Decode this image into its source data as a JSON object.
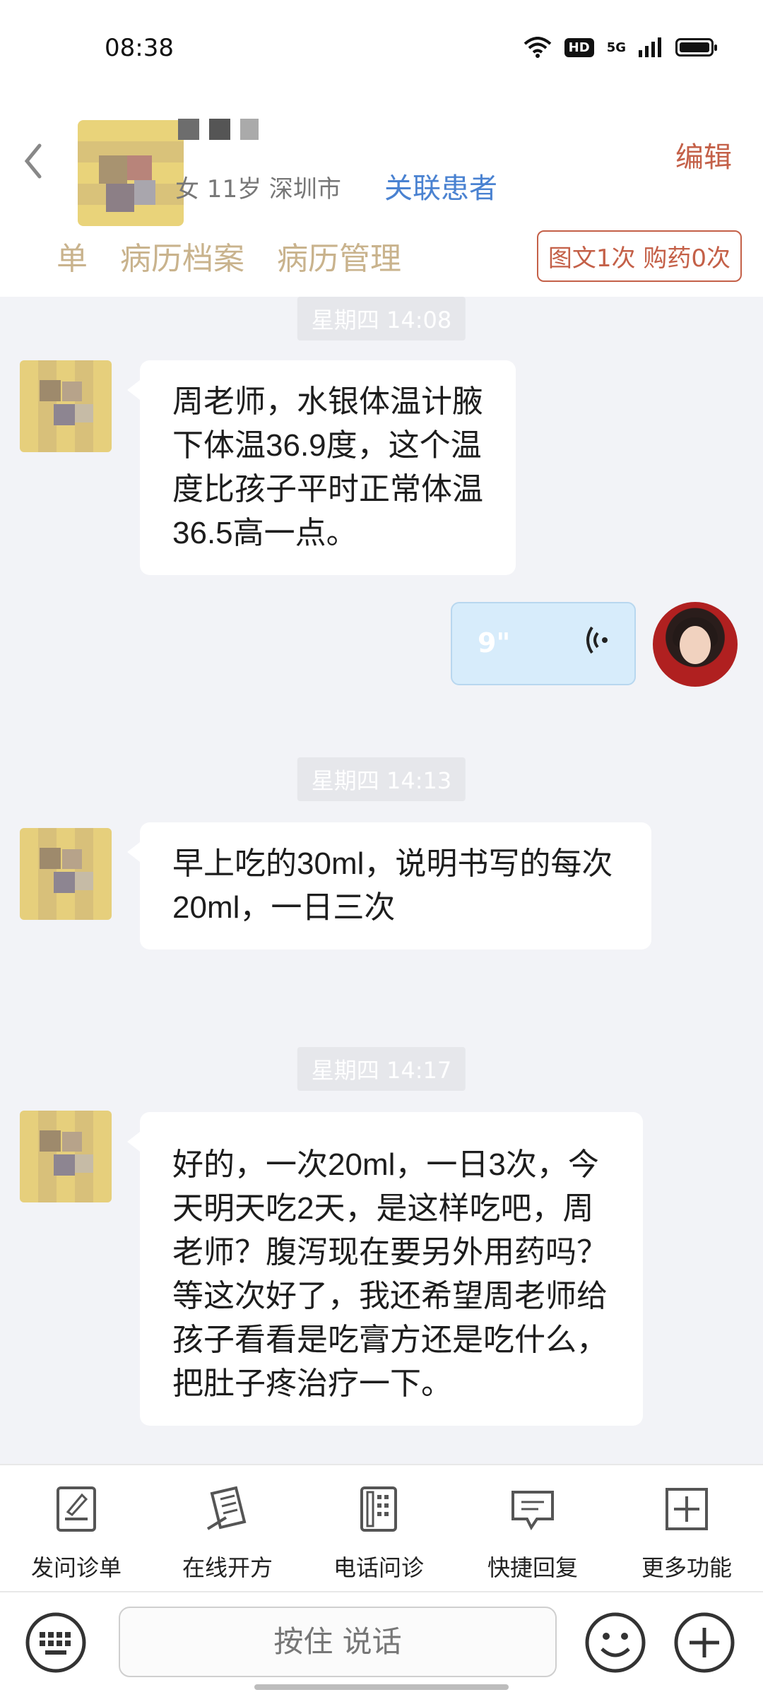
{
  "status_bar": {
    "time": "08:38",
    "hd": "HD",
    "network": "5G"
  },
  "header": {
    "patient_meta": "女 11岁  深圳市",
    "link_patient": "关联患者",
    "edit": "编辑",
    "tabs": [
      "单",
      "病历档案",
      "病历管理"
    ],
    "consult_badge": "图文1次 购药0次"
  },
  "chat": {
    "messages": [
      {
        "time": "星期四 14:08",
        "sender": "patient",
        "text": "周老师，水银体温计腋下体温36.9度，这个温度比孩子平时正常体温36.5高一点。"
      },
      {
        "sender": "doctor",
        "type": "voice",
        "duration": "9\""
      },
      {
        "time": "星期四 14:13",
        "sender": "patient",
        "text": "早上吃的30ml，说明书写的每次20ml，一日三次"
      },
      {
        "time": "星期四 14:17",
        "sender": "patient",
        "text": "好的，一次20ml，一日3次，今天明天吃2天，是这样吃吧，周老师？腹泻现在要另外用药吗？等这次好了，我还希望周老师给孩子看看是吃膏方还是吃什么，把肚子疼治疗一下。"
      }
    ]
  },
  "toolbar": {
    "items": [
      {
        "label": "发问诊单",
        "icon": "form-icon"
      },
      {
        "label": "在线开方",
        "icon": "prescription-icon"
      },
      {
        "label": "电话问诊",
        "icon": "phone-icon"
      },
      {
        "label": "快捷回复",
        "icon": "quick-reply-icon"
      },
      {
        "label": "更多功能",
        "icon": "more-icon"
      }
    ]
  },
  "input": {
    "hold_to_talk": "按住 说话"
  }
}
